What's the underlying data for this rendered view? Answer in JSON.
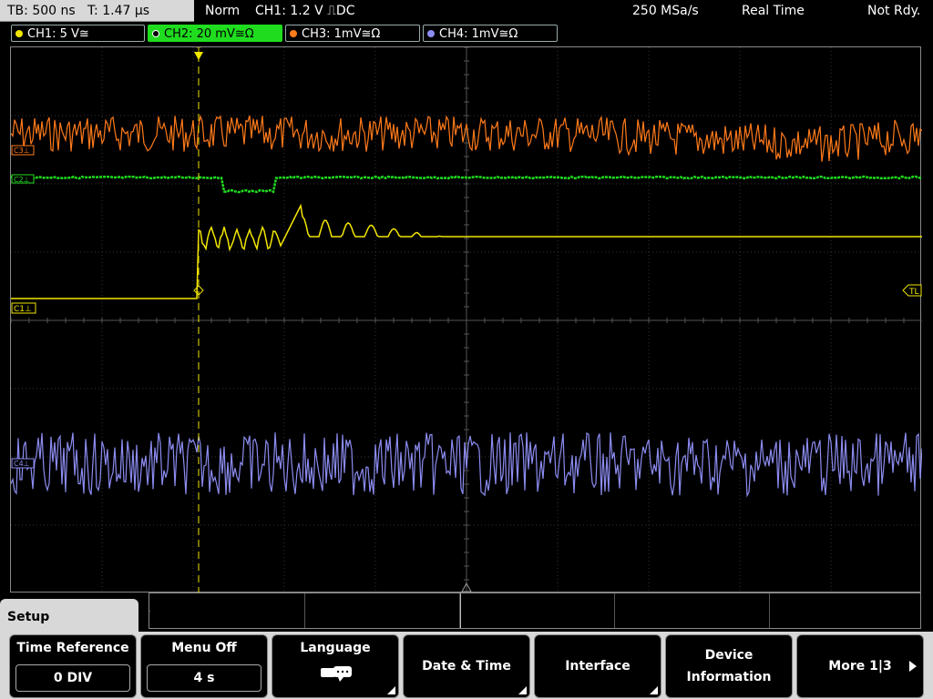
{
  "status": {
    "timebase": "TB: 500 ns",
    "trigger_time": "T: 1.47 µs",
    "mode": "Norm",
    "trigger_source": "CH1: 1.2 V",
    "trigger_slope": "⎍DC",
    "sample_rate": "250 MSa/s",
    "acq_mode": "Real Time",
    "ready_state": "Not Rdy."
  },
  "channels": [
    {
      "label": "CH1: 5 V≅",
      "color": "#f2e600"
    },
    {
      "label": "CH2: 20 mV≅Ω",
      "color": "#1fdc1f"
    },
    {
      "label": "CH3: 1mV≅Ω",
      "color": "#ff7a1a"
    },
    {
      "label": "CH4: 1mV≅Ω",
      "color": "#8c8cf2"
    }
  ],
  "markers": {
    "c1": "C1⊥",
    "c2": "C2⊥",
    "c3": "C3⊥",
    "c4": "C4⊥",
    "trigger_level": "TL",
    "trigger_pos": "T"
  },
  "menu": {
    "title": "Setup",
    "softkeys": [
      {
        "label": "Time Reference",
        "value": "0 DIV"
      },
      {
        "label": "Menu Off",
        "value": "4 s"
      },
      {
        "label": "Language",
        "icon": "speech-bubble-icon"
      },
      {
        "label": "Date & Time"
      },
      {
        "label": "Interface"
      },
      {
        "label": "Device",
        "label2": "Information"
      },
      {
        "label": "More 1|3"
      }
    ]
  }
}
